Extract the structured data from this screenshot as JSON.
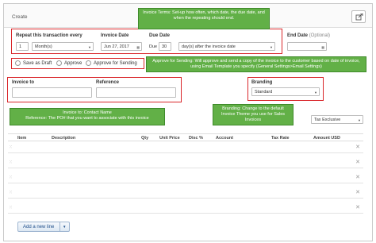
{
  "header": {
    "title": "Create"
  },
  "repeat": {
    "label": "Repeat this transaction every",
    "count": "1",
    "unit": "Month(s)"
  },
  "invoice_date": {
    "label": "Invoice Date",
    "value": "Jun 27, 2017"
  },
  "due_date": {
    "label": "Due Date",
    "prefix": "Due",
    "days": "30",
    "rule": "day(s) after the invoice date"
  },
  "end_date": {
    "label": "End Date",
    "optional": "(Optional)"
  },
  "save_options": {
    "draft": "Save as Draft",
    "approve": "Approve",
    "approve_send": "Approve for Sending"
  },
  "invoice_to": {
    "label": "Invoice to"
  },
  "reference": {
    "label": "Reference"
  },
  "branding": {
    "label": "Branding",
    "value": "Standard"
  },
  "tax_mode": {
    "value": "Tax Exclusive"
  },
  "notes": {
    "terms": "Invoice Terms: Set-up how often, which date, the due date, and when the repeating should end.",
    "sending": "Approve for Sending: Will approve and send a copy of the invoice to the customer based on date of invoice, using Email Template you specify (General Settings>Email Settings)",
    "contact": "Invoice to: Contact Name\nReference: The PO# that you want to associate with this invoice",
    "branding": "Branding: Change to the default Invoice Theme you use for Sales Invoices"
  },
  "table": {
    "columns": [
      "Item",
      "Description",
      "Qty",
      "Unit Price",
      "Disc %",
      "Account",
      "Tax Rate",
      "Amount USD"
    ],
    "rows": 5
  },
  "add_line": {
    "label": "Add a new line"
  }
}
